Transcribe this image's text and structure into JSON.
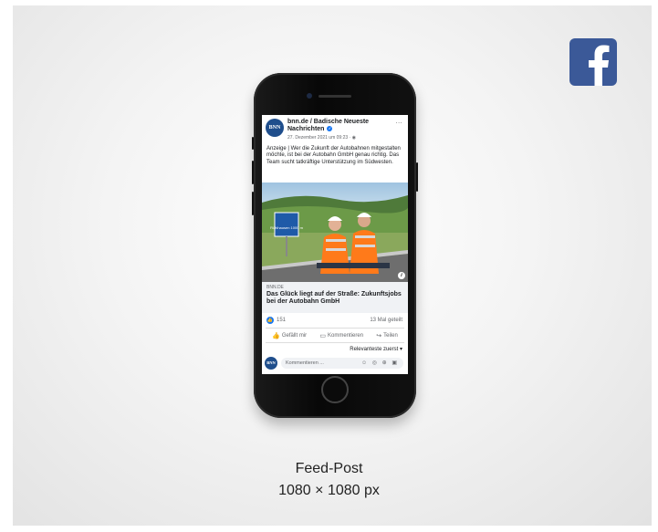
{
  "post": {
    "page_name": "bnn.de / Badische Neueste Nachrichten",
    "avatar_text": "BNN",
    "date": "27. Dezember 2021 um 09:23 · ",
    "more": "...",
    "text": "Anzeige | Wer die Zukunft der Autobahnen mitgestalten möchte, ist bei der Autobahn GmbH genau richtig. Das Team sucht tatkräftige Unterstützung im Südwesten.",
    "sign_text": "Rühlhausen 1000 m",
    "info": "i",
    "link_domain": "BNN.DE",
    "link_title": "Das Glück liegt auf der Straße: Zukunftsjobs bei der Autobahn GmbH",
    "likes": "151",
    "shares": "13 Mal geteilt",
    "actions": {
      "like": "Gefällt mir",
      "comment": "Kommentieren",
      "share": "Teilen"
    },
    "sort": "Relevanteste zuerst ▾",
    "comment_placeholder": "Kommentieren ...",
    "comment_icons": "☺ ◎ ⊕ ▣"
  },
  "caption": {
    "type": "Feed-Post",
    "size": "1080 × 1080 px"
  },
  "colors": {
    "facebook_blue": "#3b5998",
    "bnn_blue": "#1f4e8c",
    "like_blue": "#1877f2"
  },
  "icons": [
    "facebook-logo-icon",
    "verified-icon",
    "globe-icon",
    "like-icon",
    "comment-icon",
    "share-icon",
    "info-icon"
  ]
}
